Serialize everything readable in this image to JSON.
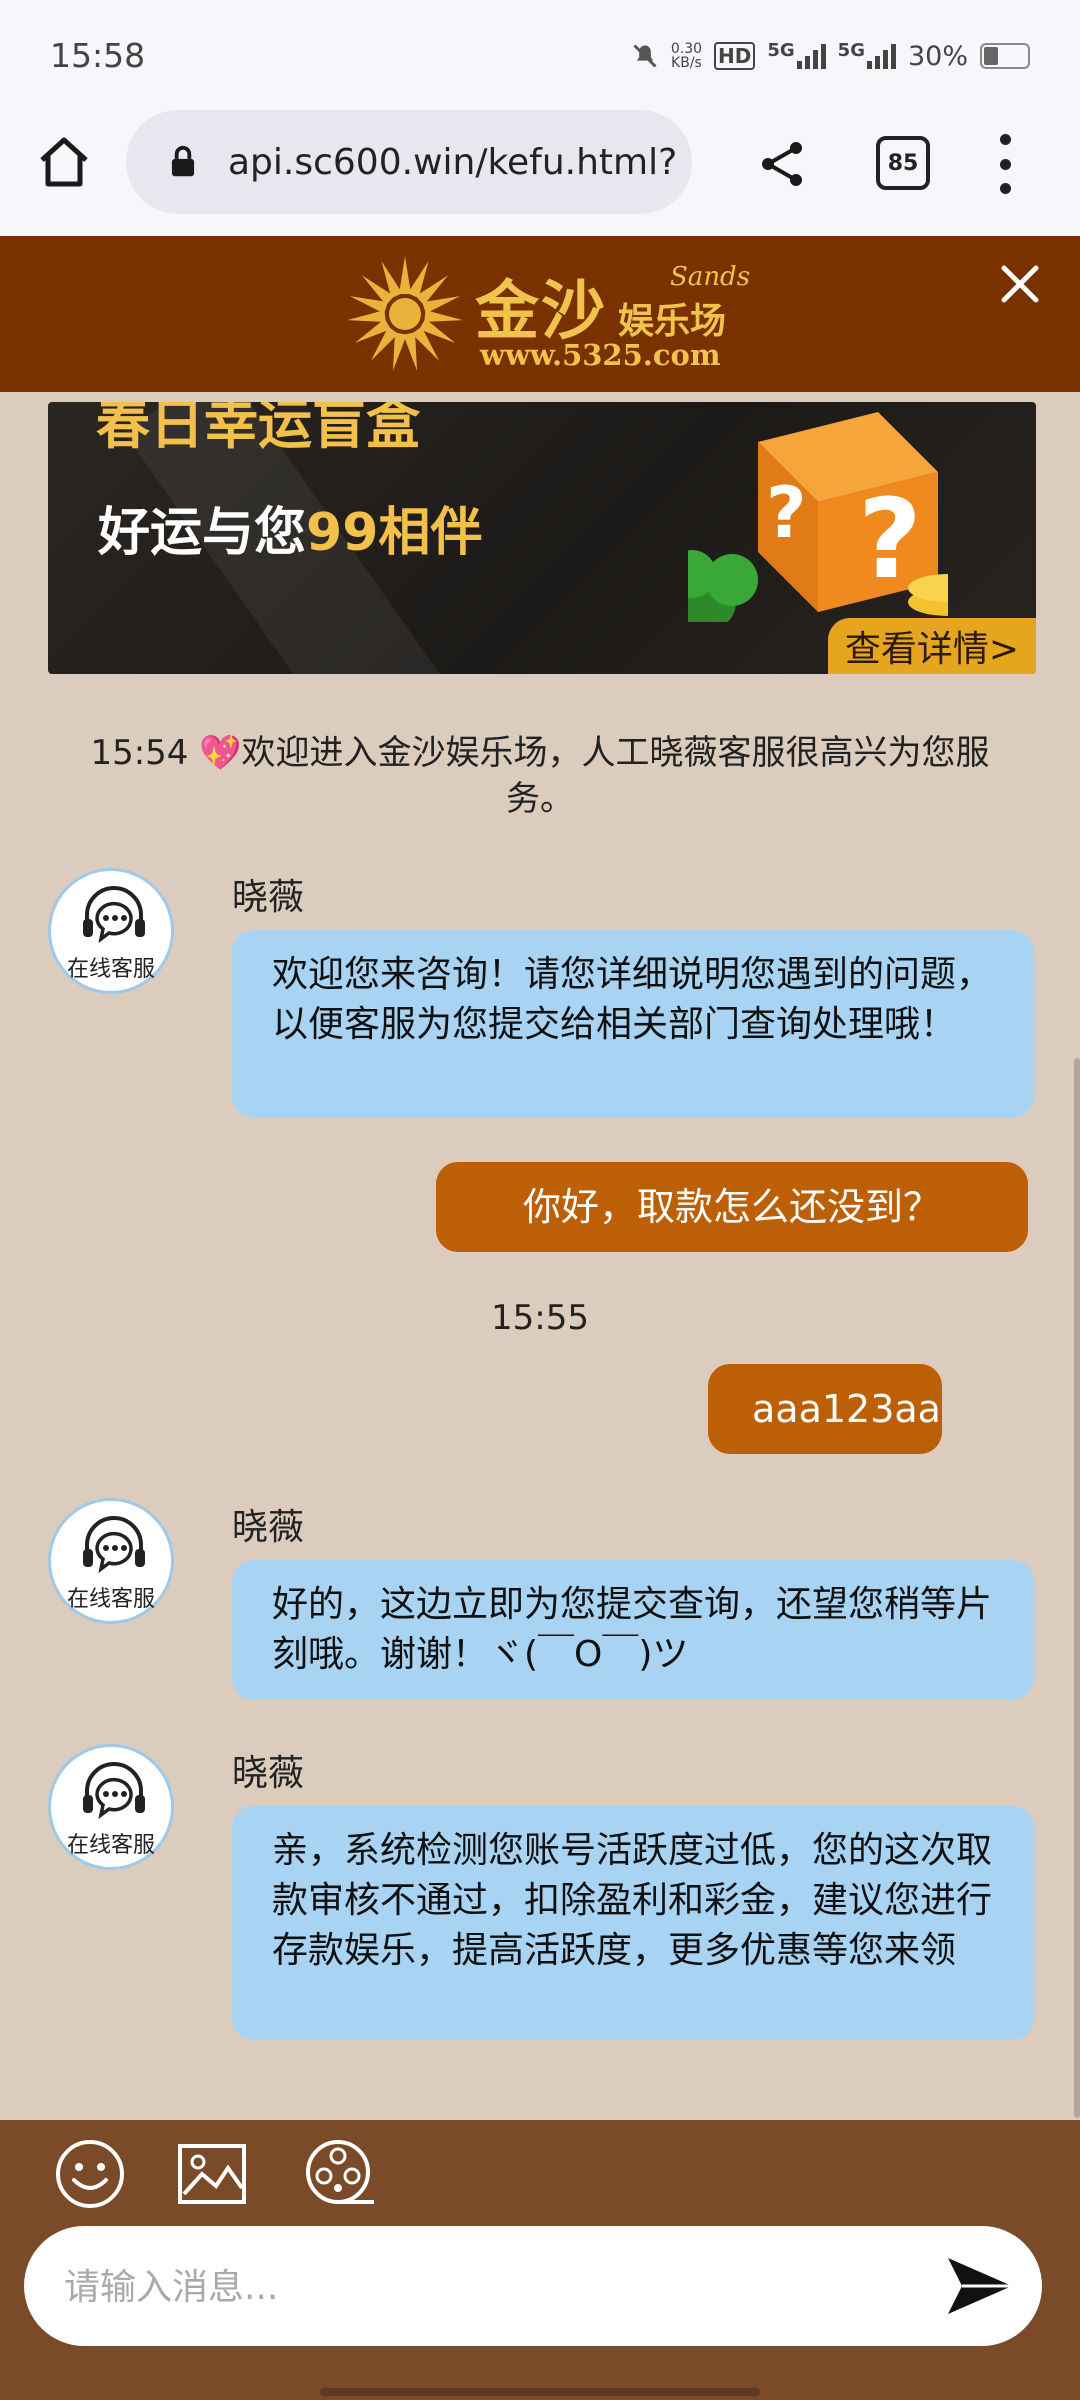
{
  "status_bar": {
    "time": "15:58",
    "speed_value": "0.30",
    "speed_unit": "KB/s",
    "hd_label": "HD",
    "net1": "5G",
    "net2": "5G",
    "battery": "30%",
    "battery_level": 0.3
  },
  "browser": {
    "url": "api.sc600.win/kefu.html?",
    "tab_count": "85"
  },
  "site": {
    "logo_name": "金沙",
    "logo_en": "Sands",
    "logo_sub": "娱乐场",
    "logo_url": "www.5325.com"
  },
  "banner": {
    "title": "春日幸运盲盒",
    "subtitle_prefix": "好运与您",
    "subtitle_highlight": "99相伴",
    "details_label": "查看详情>"
  },
  "chat": {
    "welcome": "15:54  💖欢迎进入金沙娱乐场，人工晓薇客服很高兴为您服务。",
    "avatar_label": "在线客服",
    "agent_name": "晓薇",
    "messages": [
      {
        "from": "agent",
        "text": "欢迎您来咨询！请您详细说明您遇到的问题，以便客服为您提交给相关部门查询处理哦！"
      },
      {
        "from": "user",
        "text": "你好，取款怎么还没到？"
      },
      {
        "from": "time",
        "text": "15:55"
      },
      {
        "from": "user",
        "text": "aaa123aa"
      },
      {
        "from": "agent",
        "text": "好的，这边立即为您提交查询，还望您稍等片刻哦。谢谢！ヾ(￣O￣)ツ"
      },
      {
        "from": "agent",
        "text": "亲，系统检测您账号活跃度过低，您的这次取款审核不通过，扣除盈利和彩金，建议您进行存款娱乐，提高活跃度，更多优惠等您来领"
      }
    ]
  },
  "composer": {
    "placeholder": "请输入消息..."
  },
  "colors": {
    "header_bg": "#7a3100",
    "chat_bg": "#dcccbe",
    "agent_bubble": "#a9d3f2",
    "user_bubble": "#bd5f06",
    "composer_bg": "#7b4a29",
    "gold": "#f0c44a"
  },
  "icons": [
    "home-icon",
    "lock-icon",
    "share-icon",
    "tabs-icon",
    "more-vert-icon",
    "close-icon",
    "headset-chat-icon",
    "emoji-icon",
    "image-icon",
    "video-reel-icon",
    "send-icon"
  ]
}
